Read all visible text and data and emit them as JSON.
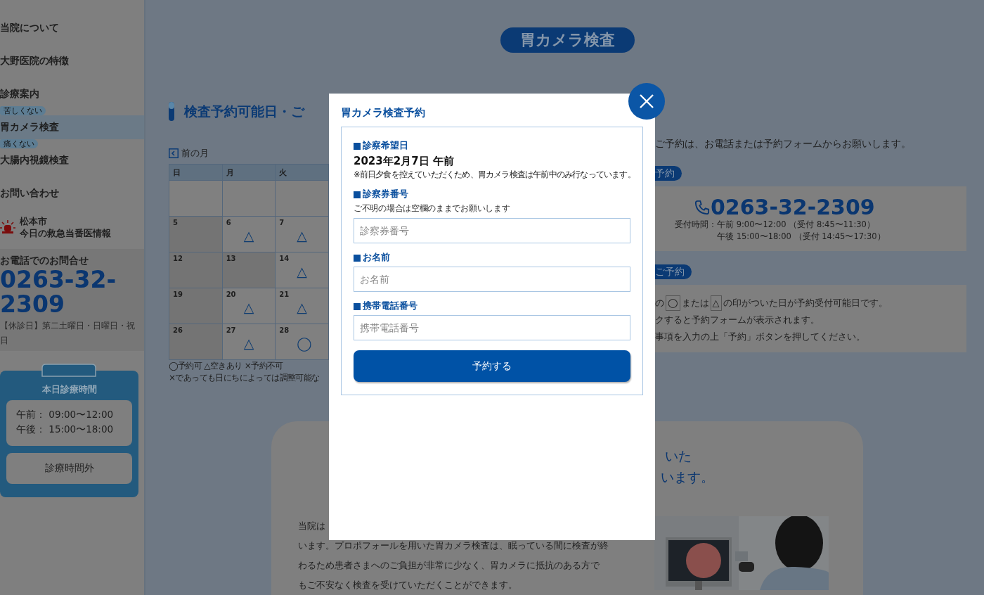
{
  "sidebar": {
    "nav": [
      {
        "label": "当院について",
        "selected": false
      },
      {
        "label": "大野医院の特徴",
        "selected": false
      },
      {
        "label": "診療案内",
        "selected": false
      },
      {
        "label": "胃カメラ検査",
        "tag": "苦しくない",
        "selected": true
      },
      {
        "label": "大腸内視鏡検査",
        "tag": "痛くない",
        "selected": false
      },
      {
        "label": "お問い合わせ",
        "selected": false
      }
    ],
    "emergency": [
      "松本市",
      "今日の救急当番医情報"
    ],
    "phone": {
      "heading": "お電話でのお問合せ",
      "number": "0263-32-2309",
      "holidays": "【休診日】第二土曜日・日曜日・祝日"
    },
    "hours": {
      "title": "本日診療時間",
      "rows": [
        {
          "label": "午前：",
          "time": "09:00〜12:00"
        },
        {
          "label": "午後：",
          "time": "15:00〜18:00"
        }
      ],
      "status": "診療時間外"
    }
  },
  "page_title": "胃カメラ検査",
  "calendar_section": {
    "heading": "検査予約可能日・ご",
    "prev_month": "前の月",
    "weekdays": [
      "日",
      "月",
      "火"
    ],
    "weeks": [
      [
        {
          "closed": false
        },
        {
          "closed": false
        },
        {
          "closed": false
        }
      ],
      [
        {
          "day": "5",
          "closed": true
        },
        {
          "day": "6",
          "mark": "△",
          "closed": false
        },
        {
          "day": "7",
          "mark": "△",
          "closed": false
        }
      ],
      [
        {
          "day": "12",
          "closed": true
        },
        {
          "day": "13",
          "closed": true
        },
        {
          "day": "14",
          "mark": "△",
          "closed": false
        }
      ],
      [
        {
          "day": "19",
          "closed": true
        },
        {
          "day": "20",
          "mark": "△",
          "closed": false
        },
        {
          "day": "21",
          "mark": "△",
          "closed": false
        }
      ],
      [
        {
          "day": "26",
          "closed": true
        },
        {
          "day": "27",
          "mark": "△",
          "closed": false
        },
        {
          "day": "28",
          "mark": "◯",
          "closed": false
        }
      ]
    ],
    "legend": [
      "◯予約可 △空きあり ×予約不可",
      "×であっても日にちによっては調整可能な"
    ]
  },
  "reservation_info": {
    "intro": "ご予約は、お電話または予約フォームからお願いします。",
    "phone_label": "予約",
    "phone_number": "0263-32-2309",
    "hours_label": "受付時間：",
    "hours": [
      "午前 9:00〜12:00 （受付 8:45〜11:30）",
      "午後 15:00〜18:00 （受付 14:45〜17:30）"
    ],
    "web_label": "ご予約",
    "web_line_1": [
      {
        "kind": "text",
        "text": "の"
      },
      {
        "kind": "boxed",
        "text": "◯"
      },
      {
        "kind": "text",
        "text": "または"
      },
      {
        "kind": "boxed",
        "text": "△"
      },
      {
        "kind": "text",
        "text": "の印がついた日が予約受付可能日です。"
      }
    ],
    "web_lines": [
      "クすると予約フォームが表示されます。",
      "事項を入力の上「予約」ボタンを押してください。"
    ]
  },
  "feature": {
    "heading_lines": [
      "いた",
      "います。"
    ],
    "intro_start": "当院は",
    "lines": [
      "います。プロポフォールを用いた胃カメラ検査は、眠っている間に検査が終",
      "わるため患者さまへのご負担が非常に少なく、胃カメラに抵抗のある方で",
      "もご不安なく検査を受けていただくことができます。"
    ],
    "photo": {
      "kind": "picture"
    }
  },
  "modal": {
    "title": "胃カメラ検査予約",
    "sections": [
      {
        "kind": "date",
        "label": "診察希望日",
        "value": "2023年2月7日 午前",
        "note": "※前日夕食を控えていただくため、胃カメラ検査は午前中のみ行なっています。"
      },
      {
        "kind": "input",
        "label": "診察券番号",
        "hint": "ご不明の場合は空欄のままでお願いします",
        "placeholder": "診察券番号"
      },
      {
        "kind": "input",
        "label": "お名前",
        "placeholder": "お名前"
      },
      {
        "kind": "input",
        "label": "携帯電話番号",
        "placeholder": "携帯電話番号"
      }
    ],
    "submit": "予約する"
  }
}
